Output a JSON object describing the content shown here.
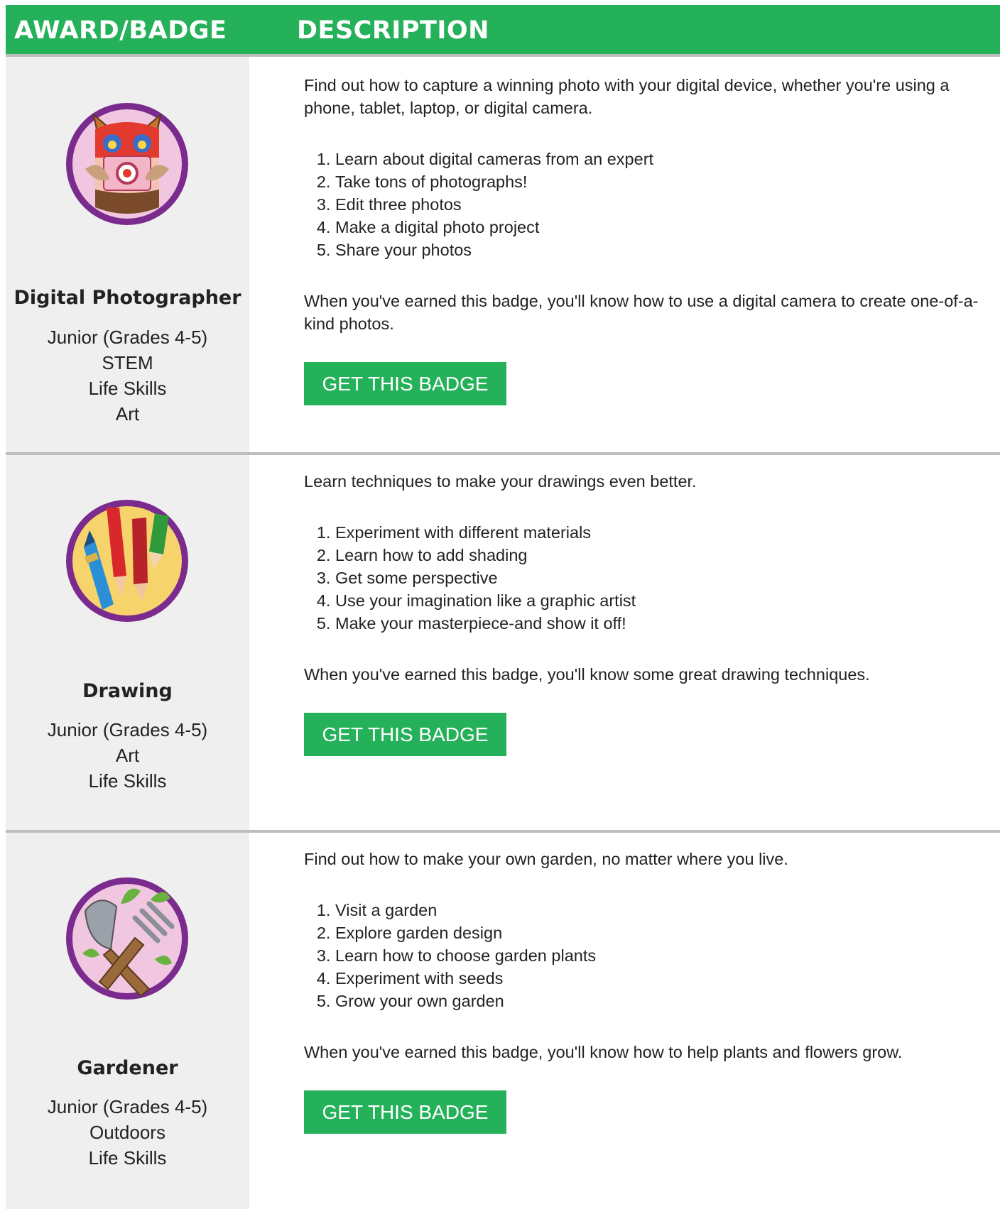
{
  "header": {
    "col1": "AWARD/BADGE",
    "col2": "DESCRIPTION"
  },
  "colors": {
    "accent": "#25b05a",
    "sidebar_bg": "#efefef",
    "rule": "#bdbdbd",
    "badge_ring": "#7b2a8e"
  },
  "badges": [
    {
      "name": "Digital Photographer",
      "icon": "camera-owl-badge-icon",
      "categories": [
        "Junior (Grades 4-5)",
        "STEM",
        "Life Skills",
        "Art"
      ],
      "intro": "Find out how to capture a winning photo with your digital device, whether you're using a phone, tablet, laptop, or digital camera.",
      "steps": [
        "Learn about digital cameras from an expert",
        "Take tons of photographs!",
        "Edit three photos",
        "Make a digital photo project",
        "Share your photos"
      ],
      "outcome": "When you've earned this badge, you'll know how to use a digital camera to create one-of-a-kind photos.",
      "button": "GET THIS BADGE"
    },
    {
      "name": "Drawing",
      "icon": "pencils-badge-icon",
      "categories": [
        "Junior (Grades 4-5)",
        "Art",
        "Life Skills"
      ],
      "intro": "Learn techniques to make your drawings even better.",
      "steps": [
        "Experiment with different materials",
        "Learn how to add shading",
        "Get some perspective",
        "Use your imagination like a graphic artist",
        "Make your masterpiece-and show it off!"
      ],
      "outcome": "When you've earned this badge, you'll know some great drawing techniques.",
      "button": "GET THIS BADGE"
    },
    {
      "name": "Gardener",
      "icon": "garden-tools-badge-icon",
      "categories": [
        "Junior (Grades 4-5)",
        "Outdoors",
        "Life Skills"
      ],
      "intro": "Find out how to make your own garden, no matter where you live.",
      "steps": [
        "Visit a garden",
        "Explore garden design",
        "Learn how to choose garden plants",
        "Experiment with seeds",
        "Grow your own garden"
      ],
      "outcome": "When you've earned this badge, you'll know how to help plants and flowers grow.",
      "button": "GET THIS BADGE"
    }
  ]
}
